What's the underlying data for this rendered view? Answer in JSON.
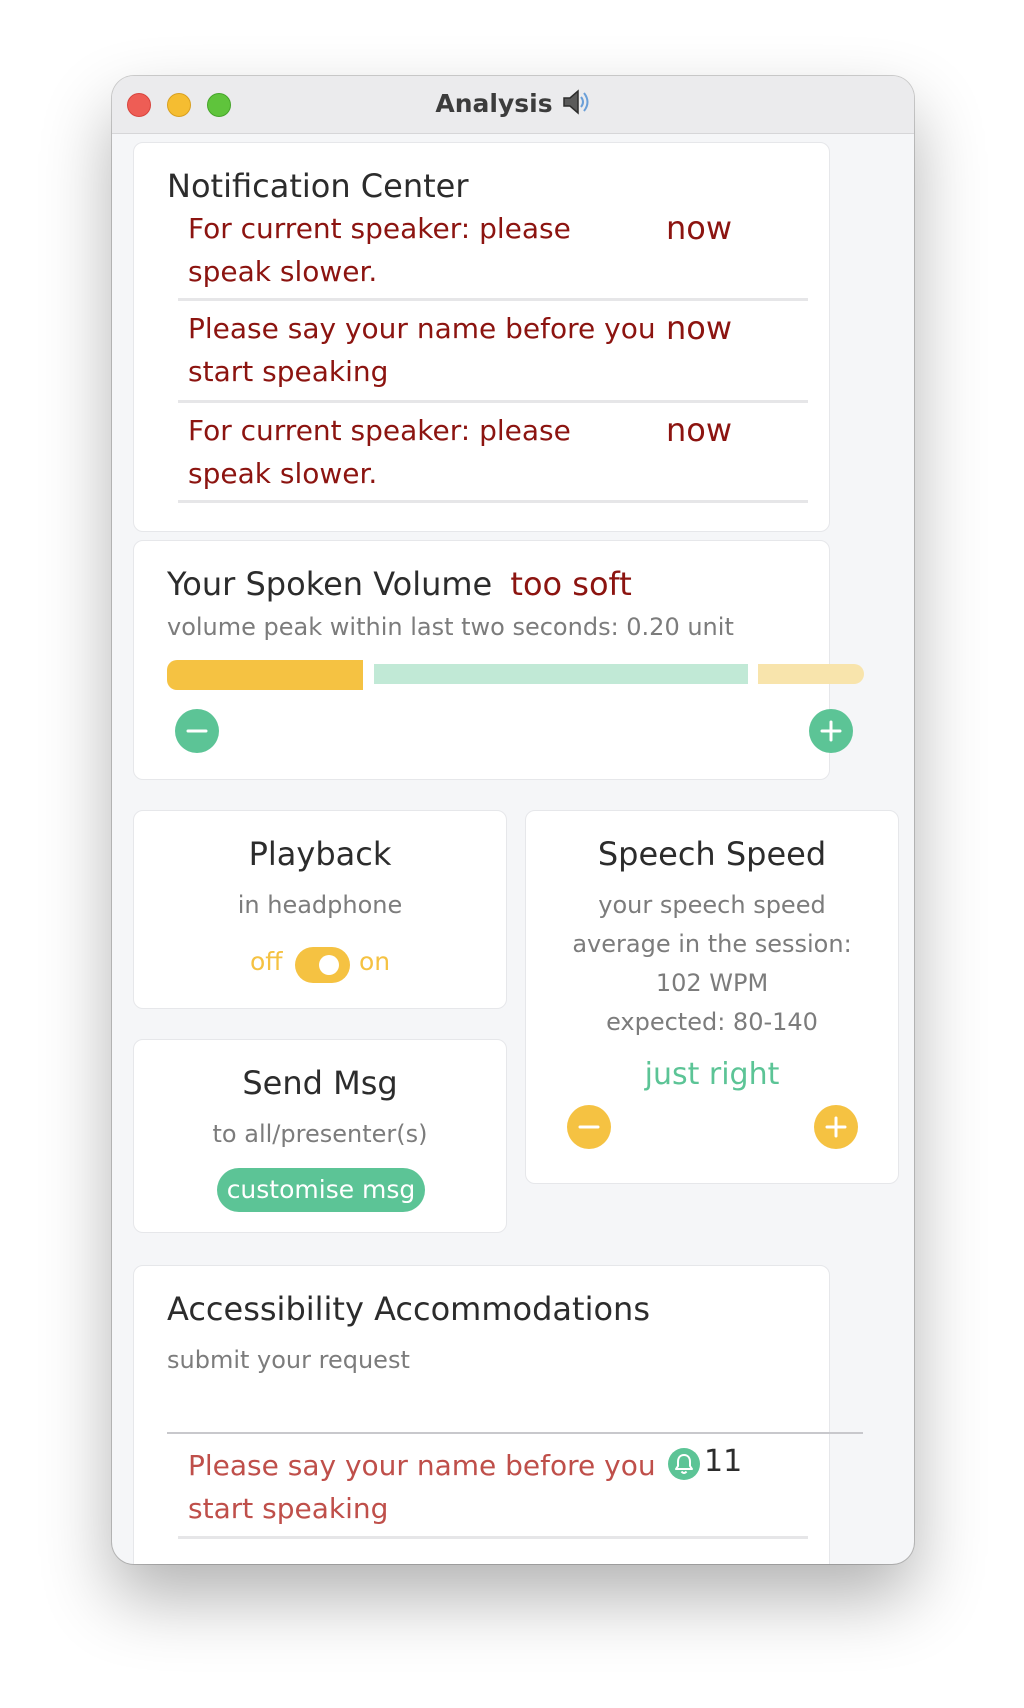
{
  "window": {
    "title": "Analysis"
  },
  "notification_center": {
    "title": "Notification Center",
    "items": [
      {
        "text": "For current speaker: please speak slower.",
        "time": "now"
      },
      {
        "text": "Please say your name before you start speaking",
        "time": "now"
      },
      {
        "text": "For current speaker: please speak slower.",
        "time": "now"
      }
    ]
  },
  "volume": {
    "title": "Your Spoken Volume",
    "status": "too soft",
    "description": "volume peak within last two seconds: 0.20 unit",
    "level": 0.2
  },
  "playback": {
    "title": "Playback",
    "subtitle": "in headphone",
    "off_label": "off",
    "on_label": "on",
    "toggle_state": "on"
  },
  "speech_speed": {
    "title": "Speech Speed",
    "line1": "your speech speed",
    "line2": "average in the session:",
    "line3": "102 WPM",
    "line4": "expected: 80-140",
    "status": "just right"
  },
  "send_msg": {
    "title": "Send Msg",
    "subtitle": "to all/presenter(s)",
    "button_label": "customise msg"
  },
  "accessibility": {
    "title": "Accessibility Accommodations",
    "subtitle": "submit your request",
    "request": {
      "text": "Please say your name before you start speaking",
      "count": "11"
    }
  },
  "colors": {
    "alert_red": "#8c1410",
    "accent_green": "#5cc496",
    "accent_yellow": "#f5c242"
  },
  "icons": [
    "speaker-icon",
    "minus-icon",
    "plus-icon",
    "bell-icon"
  ]
}
